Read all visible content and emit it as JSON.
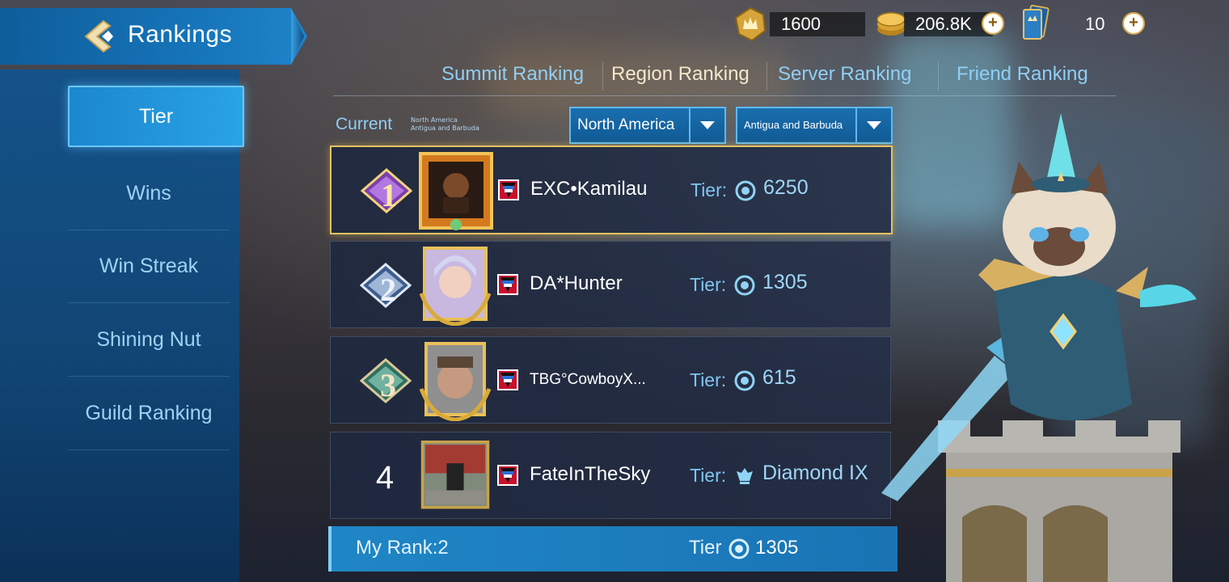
{
  "header": {
    "title": "Rankings",
    "back_icon": "back-arrow-icon"
  },
  "currency": {
    "gold_crown": {
      "icon": "crown-coin-icon",
      "value": "1600"
    },
    "coins": {
      "icon": "coin-stack-icon",
      "value": "206.8K"
    },
    "tickets": {
      "icon": "ticket-icon",
      "value": "10"
    }
  },
  "sidebar": {
    "items": [
      {
        "label": "Tier",
        "active": true
      },
      {
        "label": "Wins",
        "active": false
      },
      {
        "label": "Win Streak",
        "active": false
      },
      {
        "label": "Shining Nut",
        "active": false
      },
      {
        "label": "Guild Ranking",
        "active": false
      }
    ]
  },
  "tabs": [
    {
      "label": "Summit Ranking",
      "active": false
    },
    {
      "label": "Region Ranking",
      "active": true
    },
    {
      "label": "Server Ranking",
      "active": false
    },
    {
      "label": "Friend Ranking",
      "active": false
    }
  ],
  "filters": {
    "current_label": "Current",
    "current_region": "North America",
    "current_country": "Antigua and Barbuda",
    "region_select": "North America",
    "country_select": "Antigua and Barbuda"
  },
  "rows": [
    {
      "rank": "1",
      "name": "EXC•Kamilau",
      "tier_label": "Tier:",
      "tier_value": "6250",
      "flag": "antigua-flag-icon"
    },
    {
      "rank": "2",
      "name": "DA*Hunter",
      "tier_label": "Tier:",
      "tier_value": "1305",
      "flag": "antigua-flag-icon"
    },
    {
      "rank": "3",
      "name": "TBG°CowboyX...",
      "tier_label": "Tier:",
      "tier_value": "615",
      "flag": "antigua-flag-icon"
    },
    {
      "rank": "4",
      "name": "FateInTheSky",
      "tier_label": "Tier:",
      "tier_value": "Diamond IX",
      "flag": "antigua-flag-icon"
    }
  ],
  "my_rank": {
    "label": "My Rank:2",
    "tier_label": "Tier",
    "tier_value": "1305"
  },
  "colors": {
    "accent_blue": "#1f86c6",
    "gold_border": "#e3c261",
    "tab_active": "#f3e8cc",
    "tab_inactive": "#8fcff6"
  }
}
